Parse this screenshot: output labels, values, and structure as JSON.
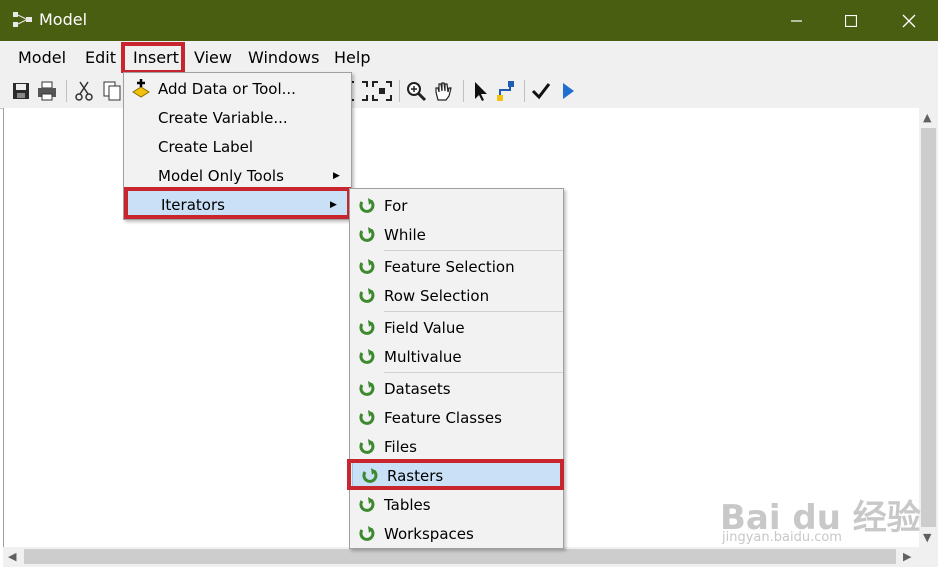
{
  "window": {
    "title": "Model"
  },
  "menubar": [
    "Model",
    "Edit",
    "Insert",
    "View",
    "Windows",
    "Help"
  ],
  "insert_menu": [
    {
      "label": "Add Data or Tool...",
      "icon": "add-data-icon",
      "submenu": false
    },
    {
      "label": "Create Variable...",
      "icon": "",
      "submenu": false
    },
    {
      "label": "Create Label",
      "icon": "",
      "submenu": false
    },
    {
      "label": "Model Only Tools",
      "icon": "",
      "submenu": true
    },
    {
      "label": "Iterators",
      "icon": "",
      "submenu": true,
      "highlighted": true
    }
  ],
  "iterators_menu": [
    {
      "label": "For"
    },
    {
      "label": "While"
    },
    {
      "label": "Feature Selection"
    },
    {
      "label": "Row Selection"
    },
    {
      "label": "Field Value"
    },
    {
      "label": "Multivalue"
    },
    {
      "label": "Datasets"
    },
    {
      "label": "Feature Classes"
    },
    {
      "label": "Files"
    },
    {
      "label": "Rasters",
      "highlighted": true
    },
    {
      "label": "Tables"
    },
    {
      "label": "Workspaces"
    }
  ],
  "watermark": {
    "brand": "Bai du 经验",
    "url": "jingyan.baidu.com"
  },
  "colors": {
    "titlebar": "#4a5e12",
    "highlight": "#c9e0f7",
    "annotation": "#c9252f",
    "iterator_icon": "#3d8a2e"
  }
}
